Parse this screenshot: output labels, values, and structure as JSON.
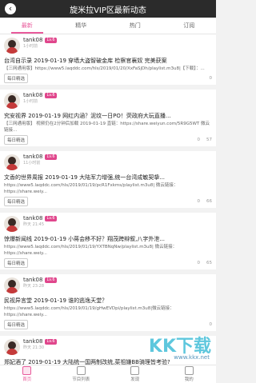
{
  "header": {
    "title": "旋米拉VIP区最新动态",
    "back_icon": "back-icon"
  },
  "tabs": [
    {
      "label": "最新",
      "active": true
    },
    {
      "label": "精华",
      "active": false
    },
    {
      "label": "热门",
      "active": false
    },
    {
      "label": "订阅",
      "active": false
    }
  ],
  "posts": [
    {
      "user": "tank08",
      "level": "Lv.6",
      "time": "1小时前",
      "content": "台湾自示录 2019-01-19 穿墙大盗智破金库 检察官襄奴 完美获案",
      "sub": "【三网通用版】https://www5.laqddc.com/hls/2019/01/20/XxFaSjDh/playlist.m3u8|【下载】：...",
      "board": "每日精选",
      "views": "",
      "comments": "0",
      "likes": ""
    },
    {
      "user": "tank08",
      "level": "Lv.6",
      "time": "1小时前",
      "content": "究安视界 2019-01-19 网红内涵？泥纹一日PO！荧政府大玩直播...",
      "sub": "【三网通用版】 视频仍在2分钟后加载 2019-01-19 直链：https://share.weiyun.com/5R9G5WT 微云链接...",
      "board": "每日精选",
      "views": "",
      "comments": "0",
      "likes": "57"
    },
    {
      "user": "tank08",
      "level": "Lv.6",
      "time": "11小时前",
      "content": "文香的世界周报 2019-01-19 大陆军力增强,统一台湾成敏契挚...",
      "sub": "https://www5.laqddc.com/hls/2019/01/19/pcR1Fxkms/playlist.m3u8| 微云链接：https://share.weiy...",
      "board": "每日精选",
      "views": "",
      "comments": "0",
      "likes": "66"
    },
    {
      "user": "tank08",
      "level": "Lv.6",
      "time": "昨天 21:45",
      "content": "惊爆新闻线 2019-01-19 小蒋会移不好？翔茂跨辩叙,八字外泄...",
      "sub": "https://www5.laqddc.com/hls/2019/01/19/YXTBNqNw/playlist.m3u8| 微云链接：https://share.weiy...",
      "board": "每日精选",
      "views": "",
      "comments": "0",
      "likes": "65"
    },
    {
      "user": "tank08",
      "level": "Lv.6",
      "time": "昨天 23:28",
      "content": "民视异言堂 2019-01-19 谁的逃逸天堂？",
      "sub": "https://www5.laqddc.com/hls/2019/01/19/gHwEVDpi/playlist.m3u8|微云链接：https://share.weiy...",
      "board": "每日精选",
      "views": "",
      "comments": "0",
      "likes": ""
    },
    {
      "user": "tank08",
      "level": "Lv.6",
      "time": "昨天 21:30",
      "content": "郑妃酒了 2019-01-19 大陆统一国两制改统,菜祖嫌BB骑理皆考验?",
      "sub": "",
      "board": "",
      "views": "",
      "comments": "",
      "likes": ""
    }
  ],
  "bottom_nav": [
    {
      "label": "首页",
      "icon": "home-icon",
      "active": true
    },
    {
      "label": "节目列表",
      "icon": "list-icon",
      "active": false
    },
    {
      "label": "发现",
      "icon": "discover-icon",
      "active": false
    },
    {
      "label": "我的",
      "icon": "profile-icon",
      "active": false
    }
  ],
  "watermark": {
    "text": "KK下载",
    "url": "www.kkx.net"
  }
}
